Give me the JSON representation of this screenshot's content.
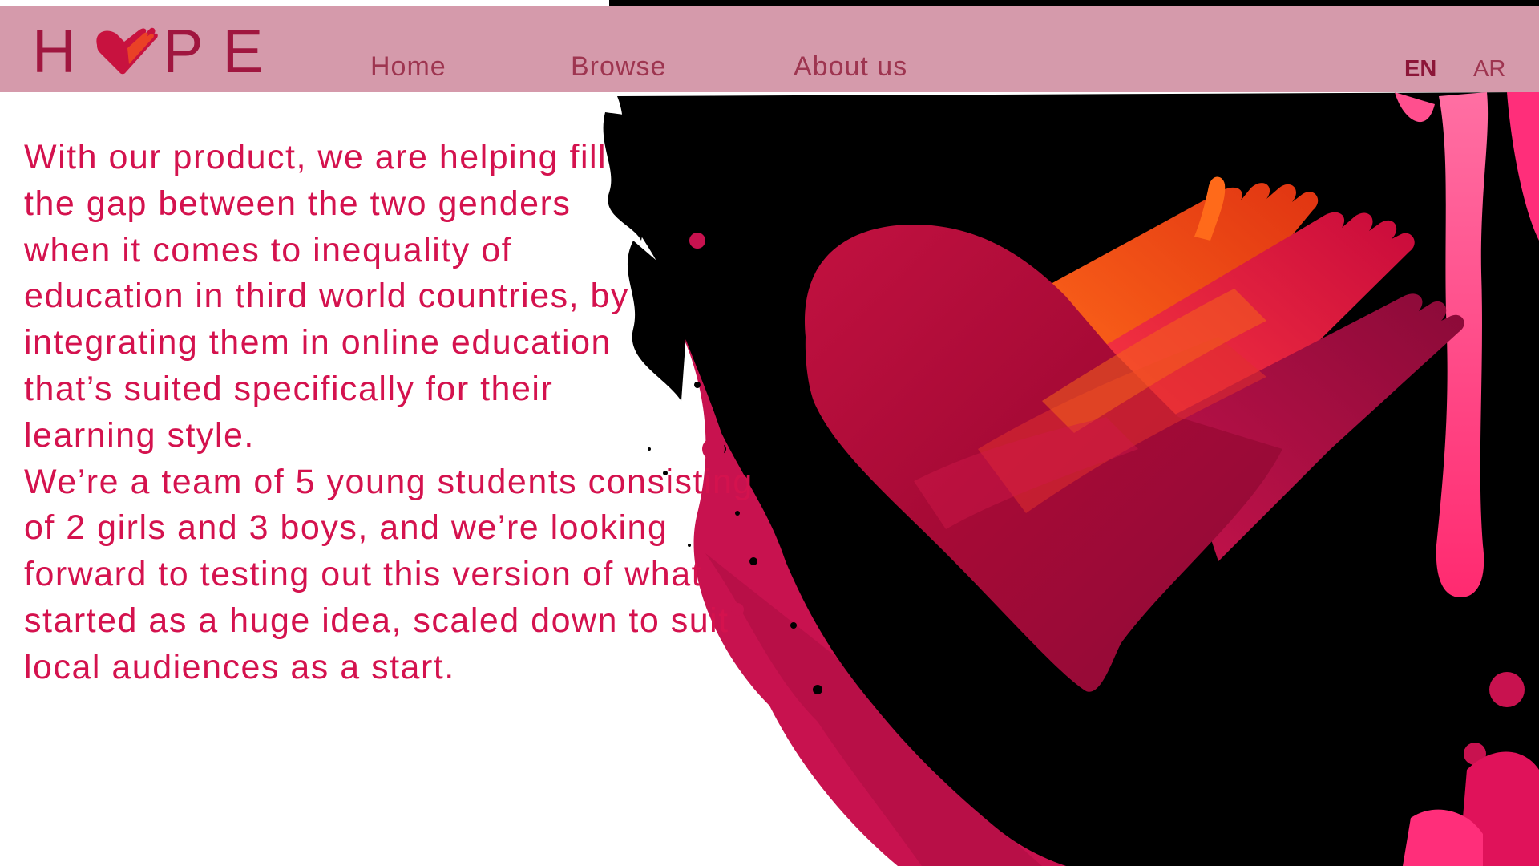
{
  "app": {
    "logo_text_left": "H",
    "logo_text_right": "PE",
    "logo_icon": "heart-hands-icon"
  },
  "nav": {
    "items": [
      {
        "label": "Home"
      },
      {
        "label": "Browse"
      },
      {
        "label": "About us"
      }
    ],
    "languages": [
      {
        "label": "EN",
        "active": true
      },
      {
        "label": "AR",
        "active": false
      }
    ]
  },
  "content": {
    "paragraph_1": "With our product, we are helping fill the gap between the two genders when it comes to inequality of education in third world countries, by integrating them in online education that’s suited specifically for their learning style.",
    "paragraph_2": "We’re a team of 5 young students consisting of 2 girls and 3 boys, and we’re looking forward to testing out this version of what started as a huge idea, scaled down to suit local audiences as a start."
  },
  "artwork": {
    "icon": "heart-hands-illustration",
    "colors": {
      "background_ink": "#000000",
      "splash_pink": "#c8124f",
      "splash_hot_pink": "#ff2e7a",
      "heart_red": "#c0103e",
      "heart_orange": "#f04a12"
    }
  },
  "theme": {
    "navbar": "#d59aab",
    "accent": "#d4124e",
    "nav_text": "#9e3550",
    "logo": "#a0163f"
  }
}
